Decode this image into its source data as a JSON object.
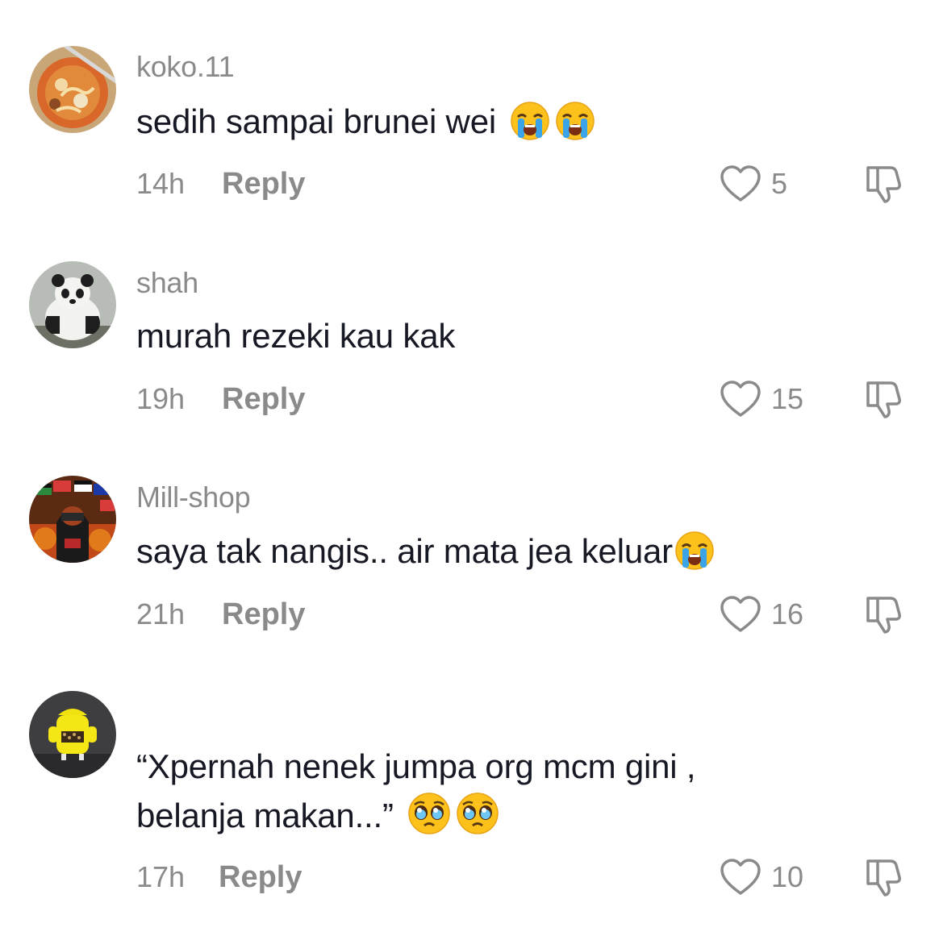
{
  "comments": [
    {
      "username": "koko.11",
      "text": "sedih sampai brunei wei ",
      "emojis": [
        "loudly-crying-face",
        "loudly-crying-face"
      ],
      "time": "14h",
      "reply_label": "Reply",
      "likes": "5"
    },
    {
      "username": "shah",
      "text": "murah rezeki kau kak",
      "emojis": [],
      "time": "19h",
      "reply_label": "Reply",
      "likes": "15"
    },
    {
      "username": "Mill-shop",
      "text": "saya tak nangis.. air mata jea keluar",
      "emojis": [
        "loudly-crying-face"
      ],
      "time": "21h",
      "reply_label": "Reply",
      "likes": "16"
    },
    {
      "username": "",
      "text_line1": "“Xpernah nenek jumpa org mcm gini ,",
      "text_line2": "belanja makan...” ",
      "emojis": [
        "pleading-face",
        "pleading-face"
      ],
      "time": "17h",
      "reply_label": "Reply",
      "likes": "10"
    }
  ],
  "icons": {
    "like": "heart-outline-icon",
    "dislike": "thumbs-down-icon"
  },
  "colors": {
    "text": "#161823",
    "muted": "#8a8a8a",
    "emoji_yellow": "#fcc21b",
    "tear_blue": "#3ba4e8"
  }
}
